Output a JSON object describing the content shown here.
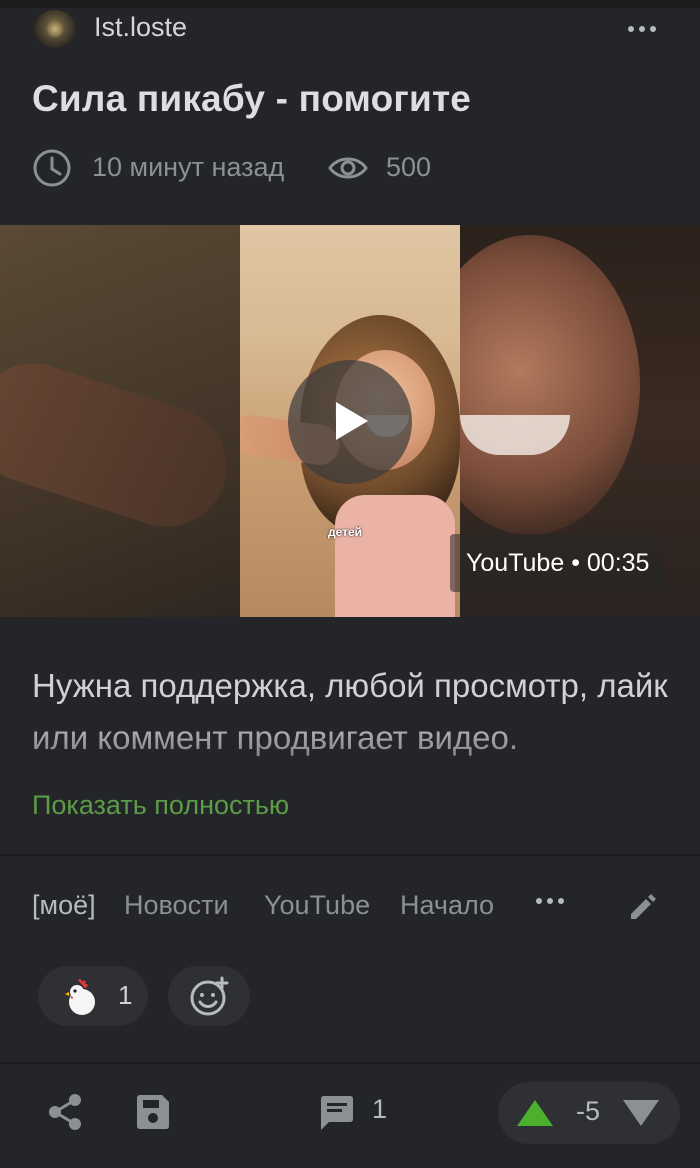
{
  "post": {
    "author": "Ist.loste",
    "title": "Сила пикабу - помогите",
    "time": "10 минут назад",
    "views": "500",
    "video": {
      "caption": "детей",
      "badge": "YouTube • 00:35"
    },
    "description": "Нужна поддержка, любой просмотр, лайк или коммент продвигает видео.",
    "show_more": "Показать полностью",
    "tags": [
      "[моё]",
      "Новости",
      "YouTube",
      "Начало"
    ],
    "reactions": [
      {
        "icon": "chicken-icon",
        "count": "1"
      }
    ],
    "comments_count": "1",
    "rating": "-5"
  },
  "colors": {
    "background": "#242528",
    "accent_green": "#5c9b47",
    "upvote_green": "#4caf2e",
    "muted_text": "#8c8f94"
  }
}
